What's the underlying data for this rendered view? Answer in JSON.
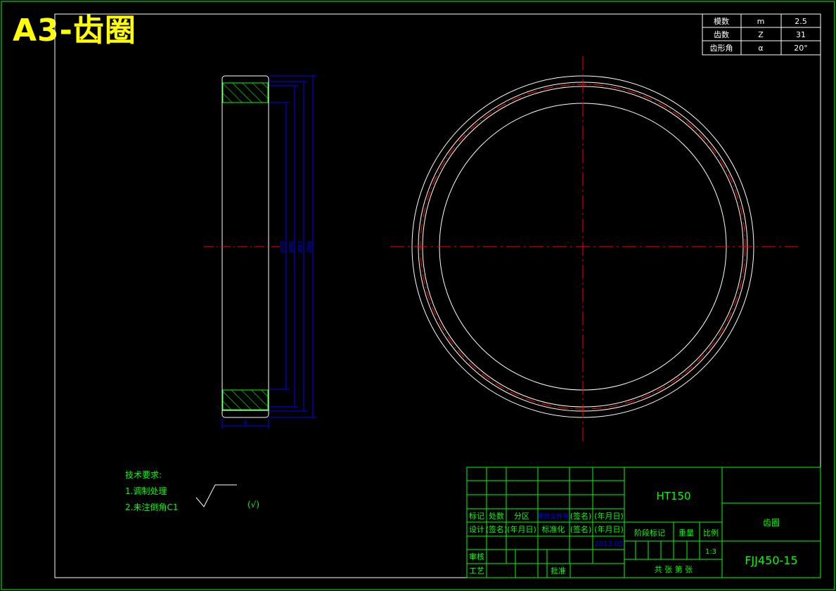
{
  "sheet_title": "A3-齿圈",
  "colors": {
    "background": "#000000",
    "frame": "#00ff00",
    "geometry": "#ffffff",
    "center_line": "#ff0000",
    "dimension": "#0000ff",
    "hatch": "#00ff00",
    "title_yellow": "#ffff00"
  },
  "gear_params": [
    {
      "name": "模数",
      "symbol": "m",
      "value": "2.5"
    },
    {
      "name": "齿数",
      "symbol": "Z",
      "value": "31"
    },
    {
      "name": "齿形角",
      "symbol": "α",
      "value": "20°"
    }
  ],
  "dimensions": {
    "d1": "Ø78",
    "d2": "Ø80",
    "d3": "Ø87",
    "d4": "Ø88",
    "width": "8"
  },
  "tech_requirements": {
    "heading": "技术要求:",
    "items": [
      "1.调制处理",
      "2.未注倒角C1"
    ],
    "roughness_note": "(√)"
  },
  "title_block": {
    "material": "HT150",
    "part_name": "齿圈",
    "drawing_number": "FJJ450-15",
    "scale": "1:3",
    "date": "2013.05",
    "row_labels": {
      "mark": "标记",
      "count": "处数",
      "zone": "分区",
      "change_doc": "更改文件号",
      "signature": "(签名)",
      "date": "(年月日)",
      "design": "设计",
      "standardize": "标准化",
      "check": "审核",
      "process": "工艺",
      "approve": "批准",
      "stage_mark": "阶段标记",
      "weight": "重量",
      "ratio": "比例",
      "sheets": "共 张 第 张"
    }
  }
}
